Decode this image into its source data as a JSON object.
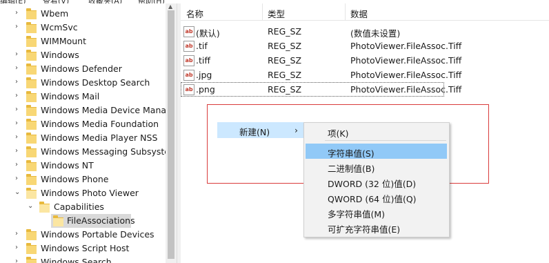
{
  "menubar": {
    "items": [
      "编辑(E)",
      "查看(V)",
      "收藏夹(A)",
      "帮助(H)"
    ]
  },
  "tree": {
    "items": [
      {
        "label": "Wbem"
      },
      {
        "label": "WcmSvc"
      },
      {
        "label": "WIMMount"
      },
      {
        "label": "Windows"
      },
      {
        "label": "Windows Defender"
      },
      {
        "label": "Windows Desktop Search"
      },
      {
        "label": "Windows Mail"
      },
      {
        "label": "Windows Media Device Manag"
      },
      {
        "label": "Windows Media Foundation"
      },
      {
        "label": "Windows Media Player NSS"
      },
      {
        "label": "Windows Messaging Subsyster"
      },
      {
        "label": "Windows NT"
      },
      {
        "label": "Windows Phone"
      },
      {
        "label": "Windows Photo Viewer"
      },
      {
        "label": "Capabilities"
      },
      {
        "label": "FileAssociations"
      },
      {
        "label": "Windows Portable Devices"
      },
      {
        "label": "Windows Script Host"
      },
      {
        "label": "Windows Search"
      }
    ]
  },
  "list": {
    "headers": {
      "name": "名称",
      "type": "类型",
      "data": "数据"
    },
    "rows": [
      {
        "name": "(默认)",
        "type": "REG_SZ",
        "data": "(数值未设置)"
      },
      {
        "name": ".tif",
        "type": "REG_SZ",
        "data": "PhotoViewer.FileAssoc.Tiff"
      },
      {
        "name": ".tiff",
        "type": "REG_SZ",
        "data": "PhotoViewer.FileAssoc.Tiff"
      },
      {
        "name": ".jpg",
        "type": "REG_SZ",
        "data": "PhotoViewer.FileAssoc.Tiff"
      },
      {
        "name": ".png",
        "type": "REG_SZ",
        "data": "PhotoViewer.FileAssoc.Tiff"
      }
    ],
    "icon_text": "ab"
  },
  "context_menu": {
    "new_label": "新建(N)",
    "arrow": "›"
  },
  "submenu": {
    "items": [
      "项(K)",
      "字符串值(S)",
      "二进制值(B)",
      "DWORD (32 位)值(D)",
      "QWORD (64 位)值(Q)",
      "多字符串值(M)",
      "可扩充字符串值(E)"
    ],
    "highlighted_index": 1
  },
  "colors": {
    "highlight": "#91c9f7",
    "selection": "#cce8ff",
    "annotation": "#d93b3b",
    "folder": "#f8d775"
  }
}
